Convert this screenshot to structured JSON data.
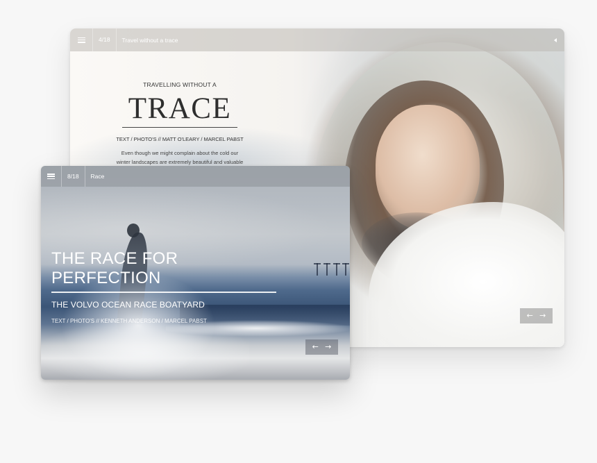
{
  "back_window": {
    "page_count": "4/18",
    "title": "Travel without a trace",
    "article": {
      "kicker": "TRAVELLING WITHOUT A",
      "headline": "TRACE",
      "credits": "TEXT / PHOTO'S  //  MATT O'LEARY /  MARCEL PABST",
      "body_line_1": "Even though we might complain about the cold our",
      "body_line_2": "winter landscapes are extremely beautiful and valuable"
    },
    "nav": {
      "prev": "←",
      "next": "→"
    }
  },
  "front_window": {
    "page_count": "8/18",
    "title": "Race",
    "feature": {
      "headline": "THE RACE FOR PERFECTION",
      "subtitle": "THE VOLVO OCEAN RACE BOATYARD",
      "credits": "TEXT / PHOTO'S // KENNETH ANDERSON / MARCEL PABST"
    },
    "nav": {
      "prev": "←",
      "next": "→"
    }
  },
  "icons": {
    "menu": "hamburger-menu-icon",
    "collapse": "triangle-left-icon",
    "prev": "arrow-left-icon",
    "next": "arrow-right-icon"
  },
  "colors": {
    "page_background": "#f7f7f7",
    "headline_dark": "#2e2e2e",
    "overlay_text": "#ffffff"
  }
}
